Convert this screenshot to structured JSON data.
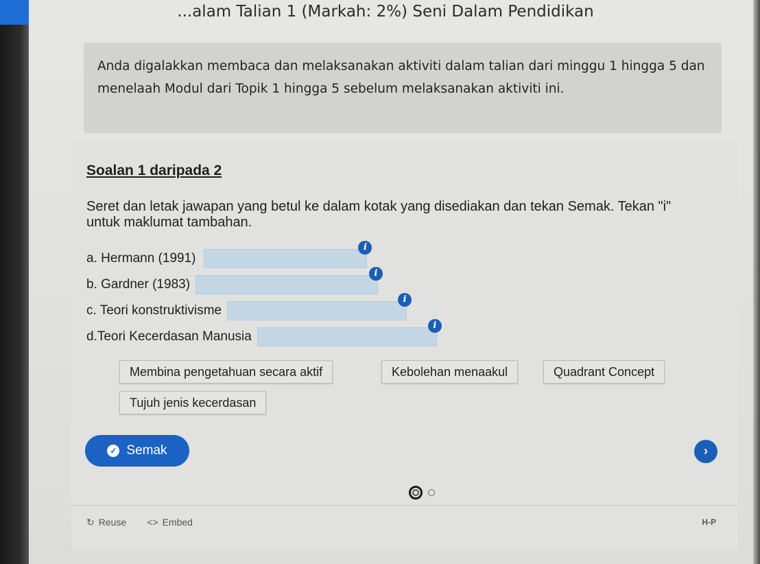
{
  "page": {
    "title": "...alam Talian 1 (Markah: 2%) Seni Dalam Pendidikan",
    "intro": "Anda digalakkan membaca dan melaksanakan aktiviti dalam talian dari minggu 1 hingga 5 dan menelaah Modul dari Topik 1 hingga 5 sebelum melaksanakan aktiviti ini."
  },
  "question": {
    "heading": "Soalan 1 daripada 2",
    "instruction": "Seret dan letak jawapan yang betul ke dalam kotak yang disediakan dan tekan Semak. Tekan \"i\" untuk maklumat tambahan.",
    "items": [
      {
        "label": "a. Hermann (1991)",
        "info": "i"
      },
      {
        "label": "b. Gardner (1983)",
        "info": "i"
      },
      {
        "label": "c. Teori konstruktivisme",
        "info": "i"
      },
      {
        "label": "d.Teori Kecerdasan Manusia",
        "info": "i"
      }
    ],
    "options": [
      "Membina pengetahuan secara aktif",
      "Kebolehan menaakul",
      "Quadrant Concept",
      "Tujuh jenis kecerdasan"
    ]
  },
  "controls": {
    "check_label": "Semak",
    "next_symbol": "›",
    "progress": {
      "current": 1,
      "total": 2
    }
  },
  "footer": {
    "reuse_label": "Reuse",
    "embed_label": "Embed",
    "h5p_label": "H-P"
  },
  "colors": {
    "accent": "#1a5fb4",
    "dropzone": "#c3d6e4",
    "background": "#e1e1df"
  }
}
